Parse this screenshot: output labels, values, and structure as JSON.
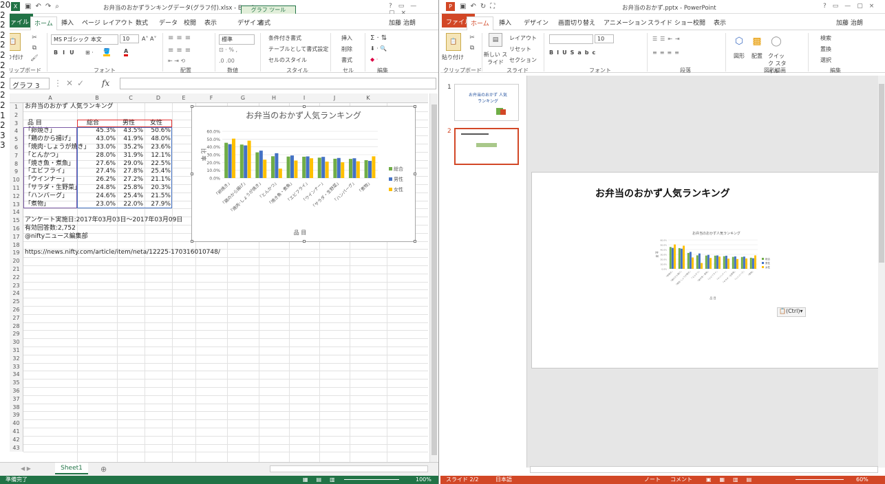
{
  "gutter_digits": [
    "20",
    "2",
    "2",
    "2",
    "2",
    "2",
    "2",
    "2",
    "2",
    "2",
    "2",
    "1",
    "2",
    "3",
    "3"
  ],
  "excel": {
    "title": "お弁当のおかずランキングデータ(グラフ付).xlsx - Excel",
    "context_tab": "グラフ ツール",
    "tabs": [
      "ファイル",
      "ホーム",
      "挿入",
      "ページ レイアウト",
      "数式",
      "データ",
      "校閲",
      "表示",
      "デザイン",
      "書式"
    ],
    "user": "加藤 治朗",
    "ribbon": {
      "paste": "貼り付け",
      "font_name": "MS Pゴシック 本文",
      "font_size": "10",
      "number_format": "標準",
      "conditional": "条件付き書式",
      "table_format": "テーブルとして書式設定",
      "cell_style": "セルのスタイル",
      "insert": "挿入",
      "delete": "削除",
      "format": "書式",
      "groups": [
        "クリップボード",
        "フォント",
        "配置",
        "数値",
        "スタイル",
        "セル",
        "編集"
      ]
    },
    "name_box": "グラフ 3",
    "fx": "fx",
    "columns": [
      "A",
      "B",
      "C",
      "D",
      "E",
      "F",
      "G",
      "H",
      "I",
      "J",
      "K"
    ],
    "rows": [
      "1",
      "2",
      "3",
      "4",
      "5",
      "6",
      "7",
      "8",
      "9",
      "10",
      "11",
      "12",
      "13",
      "14",
      "15",
      "16",
      "17",
      "18",
      "19",
      "20",
      "21",
      "22",
      "23",
      "24",
      "25",
      "26",
      "27",
      "28",
      "29",
      "30",
      "31",
      "32",
      "33",
      "34",
      "35",
      "36",
      "37",
      "38",
      "39",
      "40",
      "41",
      "42",
      "43"
    ],
    "cells": {
      "a1": "お弁当のおかず 人気ランキング",
      "a3": "品 目",
      "b3": "総合",
      "c3": "男性",
      "d3": "女性",
      "items": [
        {
          "name": "「卵焼き」",
          "t": "45.3%",
          "m": "43.5%",
          "f": "50.6%"
        },
        {
          "name": "「鶏のから揚げ」",
          "t": "43.0%",
          "m": "41.9%",
          "f": "48.0%"
        },
        {
          "name": "「焼肉･しょうが焼き」",
          "t": "33.0%",
          "m": "35.2%",
          "f": "23.6%"
        },
        {
          "name": "「とんかつ」",
          "t": "28.0%",
          "m": "31.9%",
          "f": "12.1%"
        },
        {
          "name": "「焼き魚・煮魚」",
          "t": "27.6%",
          "m": "29.0%",
          "f": "22.5%"
        },
        {
          "name": "「エビフライ」",
          "t": "27.4%",
          "m": "27.8%",
          "f": "25.4%"
        },
        {
          "name": "「ウインナー」",
          "t": "26.2%",
          "m": "27.2%",
          "f": "21.1%"
        },
        {
          "name": "「サラダ・生野菜」",
          "t": "24.8%",
          "m": "25.8%",
          "f": "20.3%"
        },
        {
          "name": "「ハンバーグ」",
          "t": "24.6%",
          "m": "25.4%",
          "f": "21.5%"
        },
        {
          "name": "「煮物」",
          "t": "23.0%",
          "m": "22.0%",
          "f": "27.9%"
        }
      ],
      "a15": "アンケート実施日:2017年03月03日～2017年03月09日",
      "a16": "有効回答数:2,752",
      "a17": "@niftyニュース編集部",
      "a19": "https://news.nifty.com/article/item/neta/12225-170316010748/"
    },
    "sheet": "Sheet1",
    "status": "準備完了",
    "zoom": "100%"
  },
  "chart_data": {
    "type": "bar",
    "title": "お弁当のおかず人気ランキング",
    "xlabel": "品 目",
    "ylabel": "比 率",
    "ylim": [
      0,
      0.6
    ],
    "yticks": [
      "0.0%",
      "10.0%",
      "20.0%",
      "30.0%",
      "40.0%",
      "50.0%",
      "60.0%"
    ],
    "categories": [
      "「卵焼き」",
      "「鶏のから揚げ」",
      "「焼肉･しょうが焼き」",
      "「とんかつ」",
      "「焼き魚・煮魚」",
      "「エビフライ」",
      "「ウインナー」",
      "「サラダ・生野菜」",
      "「ハンバーグ」",
      "「煮物」"
    ],
    "series": [
      {
        "name": "総合",
        "color": "#70ad47",
        "values": [
          0.453,
          0.43,
          0.33,
          0.28,
          0.276,
          0.274,
          0.262,
          0.248,
          0.246,
          0.23
        ]
      },
      {
        "name": "男性",
        "color": "#4472c4",
        "values": [
          0.435,
          0.419,
          0.352,
          0.319,
          0.29,
          0.278,
          0.272,
          0.258,
          0.254,
          0.22
        ]
      },
      {
        "name": "女性",
        "color": "#ffc000",
        "values": [
          0.506,
          0.48,
          0.236,
          0.121,
          0.225,
          0.254,
          0.211,
          0.203,
          0.215,
          0.279
        ]
      }
    ],
    "legend": "right",
    "grid": true
  },
  "ppt": {
    "title": "お弁当のおかず.pptx - PowerPoint",
    "tabs": [
      "ファイル",
      "ホーム",
      "挿入",
      "デザイン",
      "画面切り替え",
      "アニメーション",
      "スライド ショー",
      "校閲",
      "表示"
    ],
    "user": "加藤 治朗",
    "ribbon": {
      "paste": "貼り付け",
      "new_slide": "新しい スライド",
      "layout": "レイアウト",
      "reset": "リセット",
      "section": "セクション",
      "font_size": "10",
      "shape": "図形",
      "arrange": "配置",
      "quick_style": "クイック スタイル",
      "find": "検索",
      "replace": "置換",
      "select": "選択",
      "groups": [
        "クリップボード",
        "スライド",
        "フォント",
        "段落",
        "図形描画",
        "編集"
      ]
    },
    "thumb1_title": "お弁当のおかず 人気ランキング",
    "slide_numbers": [
      "1",
      "2"
    ],
    "slide_title": "お弁当のおかず人気ランキング",
    "paste_tag": "(Ctrl)",
    "status_slide": "スライド 2/2",
    "status_lang": "日本語",
    "status_notes": "ノート",
    "status_comments": "コメント",
    "zoom": "60%"
  }
}
